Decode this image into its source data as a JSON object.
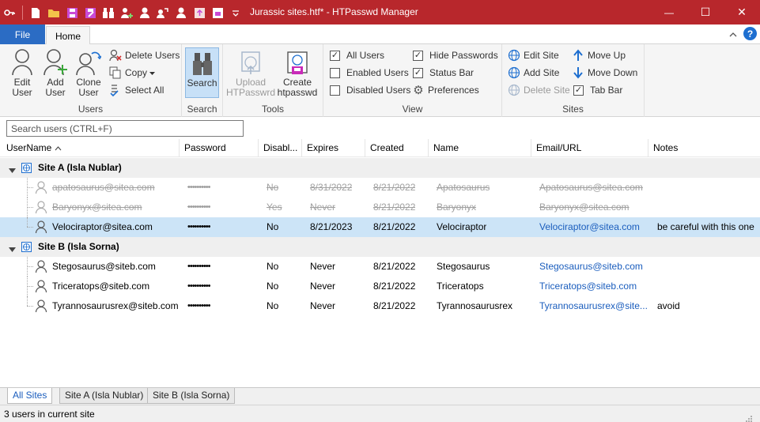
{
  "window": {
    "title": "Jurassic sites.htf* - HTPasswd Manager",
    "accent": "#b8272c",
    "minimize_glyph": "—",
    "maximize_glyph": "☐",
    "close_glyph": "✕"
  },
  "qat": {
    "icons": [
      "key-icon",
      "new-file-icon",
      "open-folder-icon",
      "save-icon",
      "save-as-icon",
      "search-binoculars-icon",
      "add-user-icon",
      "user-icon",
      "clone-user-icon",
      "edit-user-icon",
      "upload-icon",
      "create-file-icon",
      "customize-dropdown-icon"
    ]
  },
  "tabs": {
    "file": "File",
    "home": "Home"
  },
  "ribbon": {
    "users": {
      "edit_user_1": "Edit",
      "edit_user_2": "User",
      "add_user_1": "Add",
      "add_user_2": "User",
      "clone_user_1": "Clone",
      "clone_user_2": "User",
      "delete_users": "Delete Users",
      "copy": "Copy",
      "select_all": "Select All",
      "group_label": "Users"
    },
    "search": {
      "search_label": "Search",
      "group_label": "Search"
    },
    "tools": {
      "upload_1": "Upload",
      "upload_2": "HTPasswrd",
      "create_1": "Create",
      "create_2": "htpasswd",
      "group_label": "Tools"
    },
    "view": {
      "all_users": "All Users",
      "all_users_checked": true,
      "enabled_users": "Enabled Users",
      "enabled_users_checked": false,
      "disabled_users": "Disabled Users",
      "disabled_users_checked": false,
      "hide_passwords": "Hide Passwords",
      "hide_passwords_checked": true,
      "status_bar": "Status Bar",
      "status_bar_checked": true,
      "preferences": "Preferences",
      "group_label": "View"
    },
    "sites": {
      "edit_site": "Edit Site",
      "add_site": "Add Site",
      "delete_site": "Delete Site",
      "move_up": "Move Up",
      "move_down": "Move Down",
      "tab_bar": "Tab Bar",
      "tab_bar_checked": true,
      "group_label": "Sites"
    }
  },
  "search": {
    "placeholder": "Search users (CTRL+F)"
  },
  "columns": [
    "UserName",
    "Password",
    "Disabl...",
    "Expires",
    "Created",
    "Name",
    "Email/URL",
    "Notes"
  ],
  "sort_indicator": "^",
  "groups": [
    {
      "label": "Site A (Isla Nublar)",
      "rows": [
        {
          "username": "apatosaurus@sitea.com",
          "password": "••••••••••",
          "disabled": "No",
          "expires": "8/31/2022",
          "created": "8/21/2022",
          "name": "Apatosaurus",
          "email": "Apatosaurus@sitea.com",
          "notes": "",
          "state": "dim"
        },
        {
          "username": "Baryonyx@sitea.com",
          "password": "••••••••••",
          "disabled": "Yes",
          "expires": "Never",
          "created": "8/21/2022",
          "name": "Baryonyx",
          "email": "Baryonyx@sitea.com",
          "notes": "",
          "state": "dim"
        },
        {
          "username": "Velociraptor@sitea.com",
          "password": "••••••••••",
          "disabled": "No",
          "expires": "8/21/2023",
          "created": "8/21/2022",
          "name": "Velociraptor",
          "email": "Velociraptor@sitea.com",
          "notes": "be careful with this one",
          "state": "selected"
        }
      ]
    },
    {
      "label": "Site B (Isla Sorna)",
      "rows": [
        {
          "username": "Stegosaurus@siteb.com",
          "password": "••••••••••",
          "disabled": "No",
          "expires": "Never",
          "created": "8/21/2022",
          "name": "Stegosaurus",
          "email": "Stegosaurus@siteb.com",
          "notes": "",
          "state": "normal"
        },
        {
          "username": "Triceratops@siteb.com",
          "password": "••••••••••",
          "disabled": "No",
          "expires": "Never",
          "created": "8/21/2022",
          "name": "Triceratops",
          "email": "Triceratops@siteb.com",
          "notes": "",
          "state": "normal"
        },
        {
          "username": "Tyrannosaurusrex@siteb.com",
          "password": "••••••••••",
          "disabled": "No",
          "expires": "Never",
          "created": "8/21/2022",
          "name": "Tyrannosaurusrex",
          "email": "Tyrannosaurusrex@site...",
          "notes": "avoid",
          "state": "normal"
        }
      ]
    }
  ],
  "bottom_tabs": [
    "All Sites",
    "Site A (Isla Nublar)",
    "Site B (Isla Sorna)"
  ],
  "status": "3 users in current site"
}
